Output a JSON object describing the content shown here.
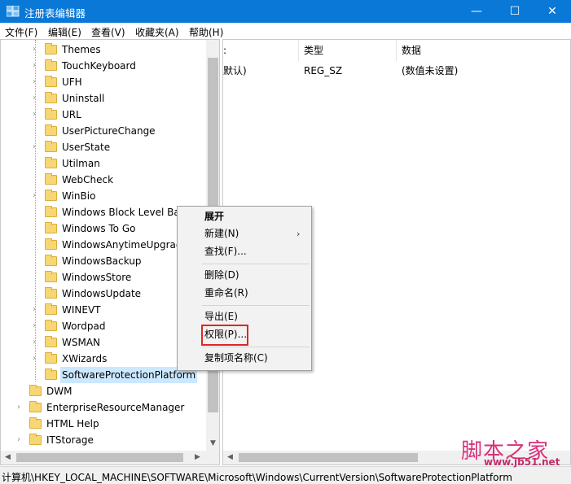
{
  "window": {
    "title": "注册表编辑器",
    "minimize_glyph": "—",
    "maximize_glyph": "☐",
    "close_glyph": "✕"
  },
  "menu": {
    "file": "文件(F)",
    "edit": "编辑(E)",
    "view": "查看(V)",
    "favorites": "收藏夹(A)",
    "help": "帮助(H)"
  },
  "tree": {
    "items": [
      {
        "label": "Themes",
        "expandable": true
      },
      {
        "label": "TouchKeyboard",
        "expandable": true
      },
      {
        "label": "UFH",
        "expandable": true
      },
      {
        "label": "Uninstall",
        "expandable": true
      },
      {
        "label": "URL",
        "expandable": true
      },
      {
        "label": "UserPictureChange",
        "expandable": false
      },
      {
        "label": "UserState",
        "expandable": true
      },
      {
        "label": "Utilman",
        "expandable": false
      },
      {
        "label": "WebCheck",
        "expandable": false
      },
      {
        "label": "WinBio",
        "expandable": true
      },
      {
        "label": "Windows Block Level Ba",
        "expandable": false
      },
      {
        "label": "Windows To Go",
        "expandable": false
      },
      {
        "label": "WindowsAnytimeUpgrac",
        "expandable": false
      },
      {
        "label": "WindowsBackup",
        "expandable": false
      },
      {
        "label": "WindowsStore",
        "expandable": false
      },
      {
        "label": "WindowsUpdate",
        "expandable": false
      },
      {
        "label": "WINEVT",
        "expandable": true
      },
      {
        "label": "Wordpad",
        "expandable": true
      },
      {
        "label": "WSMAN",
        "expandable": true
      },
      {
        "label": "XWizards",
        "expandable": true
      },
      {
        "label": "SoftwareProtectionPlatform",
        "expandable": false,
        "selected": true
      },
      {
        "label": "DWM",
        "expandable": false
      },
      {
        "label": "EnterpriseResourceManager",
        "expandable": true
      },
      {
        "label": "HTML Help",
        "expandable": false
      },
      {
        "label": "ITStorage",
        "expandable": true
      }
    ]
  },
  "values": {
    "headers": {
      "name": ":",
      "type": "类型",
      "data": "数据"
    },
    "rows": [
      {
        "name": "默认)",
        "type": "REG_SZ",
        "data": "(数值未设置)"
      }
    ]
  },
  "context_menu": {
    "expand": "展开",
    "new": "新建(N)",
    "find": "查找(F)...",
    "delete": "删除(D)",
    "rename": "重命名(R)",
    "export": "导出(E)",
    "permissions": "权限(P)...",
    "copy_key_name": "复制项名称(C)",
    "submenu_arrow": "›"
  },
  "status": {
    "path": "计算机\\HKEY_LOCAL_MACHINE\\SOFTWARE\\Microsoft\\Windows\\CurrentVersion\\SoftwareProtectionPlatform"
  },
  "watermark": {
    "title": "脚本之家",
    "url": "www.jb51.net"
  },
  "colors": {
    "titlebar": "#0a78d7",
    "selection": "#cce8ff",
    "highlight_box": "#e02626",
    "folder": "#f6d774",
    "watermark": "#d9307a"
  }
}
